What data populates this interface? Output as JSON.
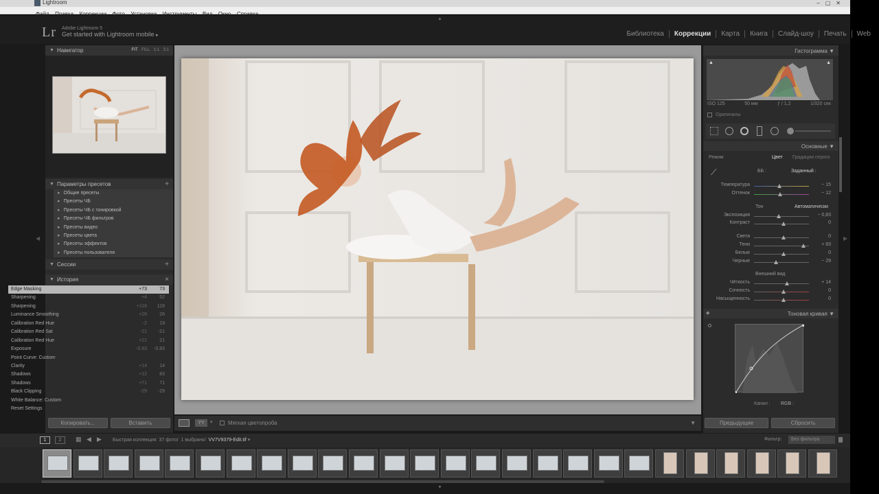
{
  "window": {
    "title": "Lightroom"
  },
  "menu": [
    "Файл",
    "Правка",
    "Коррекции",
    "Фото",
    "Установки",
    "Инструменты",
    "Вид",
    "Окно",
    "Справка"
  ],
  "identity": {
    "logo": "Lr",
    "product": "Adobe Lightroom 5",
    "mobile": "Get started with Lightroom mobile"
  },
  "modules": [
    "Библиотека",
    "Коррекции",
    "Карта",
    "Книга",
    "Слайд-шоу",
    "Печать",
    "Web"
  ],
  "left": {
    "navigator": {
      "title": "Навигатор",
      "modes": [
        "FIT",
        "FILL",
        "1:1",
        "3:1"
      ]
    },
    "presets": {
      "title": "Параметры пресетов",
      "items": [
        "Общие пресеты",
        "Пресеты ЧБ",
        "Пресеты ЧБ с тонировкой",
        "Пресеты ЧБ фильтров",
        "Пресеты видео",
        "Пресеты цвета",
        "Пресеты эффектов",
        "Пресеты пользователя"
      ]
    },
    "sessions": {
      "title": "Сессии"
    },
    "history": {
      "title": "История",
      "rows": [
        {
          "name": "Edge Masking",
          "a": "+73",
          "b": "73"
        },
        {
          "name": "Sharpening",
          "a": "+4",
          "b": "52"
        },
        {
          "name": "Sharpening",
          "a": "+118",
          "b": "118"
        },
        {
          "name": "Luminance Smoothing",
          "a": "+26",
          "b": "26"
        },
        {
          "name": "Calibration Red Hue",
          "a": "-2",
          "b": "19"
        },
        {
          "name": "Calibration Red Sat",
          "a": "-21",
          "b": "-21"
        },
        {
          "name": "Calibration Red Hue",
          "a": "+21",
          "b": "21"
        },
        {
          "name": "Exposure",
          "a": "-0.83",
          "b": "-0.83"
        },
        {
          "name": "Point Curve: Custom",
          "a": "",
          "b": ""
        },
        {
          "name": "Clarity",
          "a": "+14",
          "b": "14"
        },
        {
          "name": "Shadows",
          "a": "+12",
          "b": "83"
        },
        {
          "name": "Shadows",
          "a": "+71",
          "b": "71"
        },
        {
          "name": "Black Clipping",
          "a": "-29",
          "b": "-29"
        },
        {
          "name": "White Balance: Custom",
          "a": "",
          "b": ""
        },
        {
          "name": "Reset Settings",
          "a": "",
          "b": ""
        }
      ]
    },
    "copy_label": "Копировать...",
    "paste_label": "Вставить"
  },
  "toolbar": {
    "soft_proof": "Мягкая цветопроба"
  },
  "right": {
    "histogram": {
      "title": "Гистограмма",
      "iso": "ISO 125",
      "focal": "50 мм",
      "aperture": "ƒ / 1,2",
      "shutter": "1/320 сек",
      "originals": "Оригиналы"
    },
    "basic": {
      "title": "Основные",
      "mode_label": "Режим",
      "color": "Цвет",
      "bw": "Градации серого",
      "wb_label": "ББ :",
      "wb_value": "Заданный :",
      "temp": {
        "label": "Температура",
        "value": "− 15"
      },
      "tint": {
        "label": "Оттенок",
        "value": "− 12"
      },
      "tone_label": "Тон",
      "auto": "Автоматически",
      "exposure": {
        "label": "Экспозиция",
        "value": "− 0,83"
      },
      "contrast": {
        "label": "Контраст",
        "value": "0"
      },
      "highlights": {
        "label": "Света",
        "value": "0"
      },
      "shadows": {
        "label": "Тени",
        "value": "+ 83"
      },
      "whites": {
        "label": "Белые",
        "value": "0"
      },
      "blacks": {
        "label": "Черные",
        "value": "− 29"
      },
      "presence": "Внешний вид",
      "clarity": {
        "label": "Чёткость",
        "value": "+ 14"
      },
      "vibrance": {
        "label": "Сочность",
        "value": "0"
      },
      "saturation": {
        "label": "Насыщенность",
        "value": "0"
      }
    },
    "tonecurve": {
      "title": "Тоновая кривая",
      "channel_label": "Канал :",
      "channel": "RGB :"
    },
    "prev_label": "Предыдущие",
    "reset_label": "Сбросить"
  },
  "filmstrip": {
    "collection": "Быстрая коллекция",
    "count": "37 фото/",
    "selected": "1 выбрано/",
    "file": "VV7V9379-Edit.tif",
    "filter_label": "Фильтр:",
    "filter_value": "Без фильтра",
    "pages": [
      "1",
      "2"
    ]
  }
}
